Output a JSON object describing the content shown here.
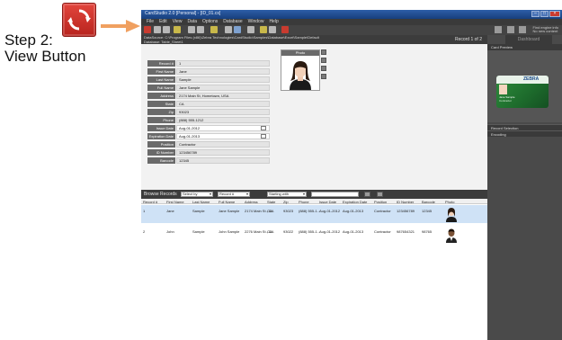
{
  "callout": {
    "step_text": "Step 2:\nView Button",
    "icon": "refresh-arrows-icon",
    "accent": "#d43a2f",
    "arrow_color": "#f0a060"
  },
  "window": {
    "title": "CardStudio 2.0 [Personal] - [ID_01.cs]",
    "controls": [
      "–",
      "□",
      "×"
    ]
  },
  "menu": [
    "File",
    "Edit",
    "View",
    "Data",
    "Options",
    "Database",
    "Window",
    "Help"
  ],
  "toolbar": {
    "right_text_line1": "Find engine info",
    "right_text_line2": "No new content"
  },
  "path": {
    "datasource": "DataSource: C:\\Program Files (x86)\\Zebra Technologies\\CardStudio\\Samples\\Database\\Excel\\Sample\\Default",
    "database": "Database: Table_Sheet1",
    "record_label": "Record 1 of 2"
  },
  "record": {
    "fields": [
      {
        "label": "Record #",
        "value": "1"
      },
      {
        "label": "First Name",
        "value": "Jane"
      },
      {
        "label": "Last Name",
        "value": "Sample"
      },
      {
        "label": "Full Name",
        "value": "Jane Sample"
      },
      {
        "label": "Address",
        "value": "2174 Main St, Hometown, USA"
      },
      {
        "label": "State",
        "value": "CA"
      },
      {
        "label": "Zip",
        "value": "93023"
      },
      {
        "label": "Phone",
        "value": "(888) 555-1212"
      },
      {
        "label": "Issue Date",
        "value": "Aug-01-2012"
      },
      {
        "label": "Expiration Date",
        "value": "Aug-01-2013"
      },
      {
        "label": "Position",
        "value": "Contractor"
      },
      {
        "label": "ID Number",
        "value": "123456789"
      },
      {
        "label": "Barcode",
        "value": "12345"
      }
    ],
    "photo_label": "Photo"
  },
  "browse": {
    "title": "Browse Records",
    "select_by": "Select by",
    "field": "Record #",
    "match": "Starting with",
    "columns": [
      "Record #",
      "First Name",
      "Last Name",
      "Full Name",
      "Address",
      "State",
      "Zip",
      "Phone",
      "Issue Date",
      "Expiration Date",
      "Position",
      "ID Number",
      "Barcode",
      "Photo"
    ],
    "rows": [
      [
        "1",
        "Jane",
        "Sample",
        "Jane Sample",
        "2174 Main St., CA",
        "CA",
        "93023",
        "(888) 555-1...",
        "Aug-01-2012",
        "Aug-01-2013",
        "Contractor",
        "123456789",
        "12345"
      ],
      [
        "2",
        "John",
        "Sample",
        "John Sample",
        "2276 Main St., CA",
        "CA",
        "93022",
        "(888) 555-1...",
        "Aug-01-2012",
        "Aug-01-2013",
        "Contractor",
        "987654321",
        "98765"
      ]
    ]
  },
  "right_panel": {
    "dashboard": "Dashboard",
    "card_preview": "Card Preview",
    "card_logo": "ZEBRA",
    "card_name": "Jane Sample",
    "card_position": "Contractor",
    "record_selection": "Record Selection",
    "encoding": "Encoding"
  }
}
